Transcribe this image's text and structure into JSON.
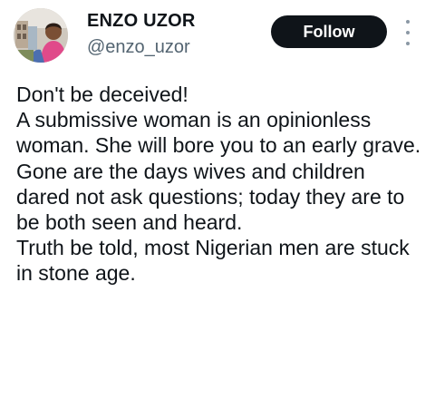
{
  "author": {
    "display_name": "ENZO UZOR",
    "handle": "@enzo_uzor",
    "avatar_icon": "profile-photo"
  },
  "follow_button": {
    "label": "Follow"
  },
  "more_menu": {
    "icon": "more-vertical-icon"
  },
  "tweet": {
    "paragraphs": [
      "Don't be deceived!",
      "A submissive woman is an opinionless woman. She will bore you to an early grave.",
      "Gone are the days wives and children dared not ask questions; today they are to be both seen and heard.",
      "Truth be told, most Nigerian men are stuck in stone age."
    ]
  },
  "colors": {
    "text": "#0f1419",
    "secondary_text": "#536471",
    "button_bg": "#0f1419",
    "button_text": "#ffffff"
  }
}
